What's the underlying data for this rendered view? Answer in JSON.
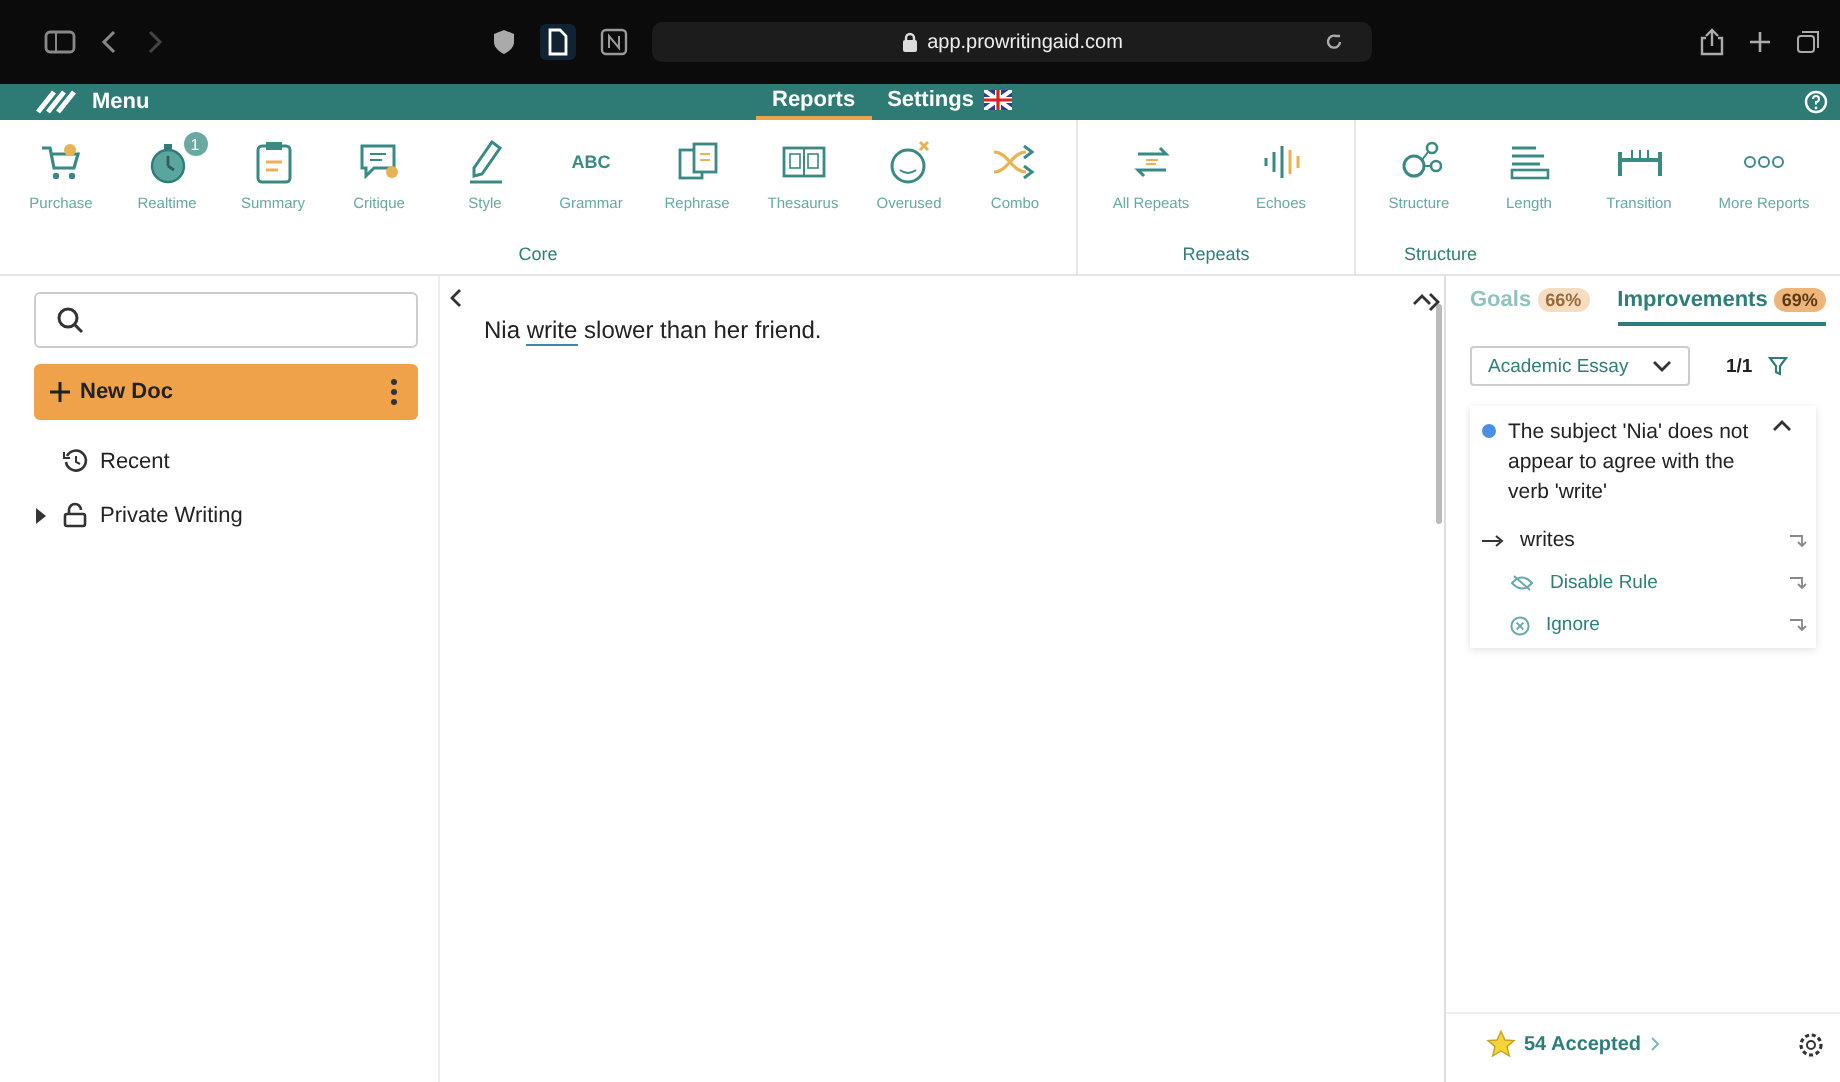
{
  "browser": {
    "url": "app.prowritingaid.com"
  },
  "menubar": {
    "title": "Menu",
    "tabs": [
      {
        "label": "Reports",
        "selected": true,
        "flag": false
      },
      {
        "label": "Settings",
        "selected": false,
        "flag": true
      }
    ]
  },
  "toolbar": {
    "groups": [
      {
        "label": "Core",
        "tools": [
          {
            "label": "Purchase",
            "kind": "cart"
          },
          {
            "label": "Realtime",
            "kind": "timer",
            "badge": "1"
          },
          {
            "label": "Summary",
            "kind": "clipboard"
          },
          {
            "label": "Critique",
            "kind": "chat"
          },
          {
            "label": "Style",
            "kind": "pen"
          },
          {
            "label": "Grammar",
            "kind": "text",
            "glyph": "ABC"
          },
          {
            "label": "Rephrase",
            "kind": "pages"
          },
          {
            "label": "Thesaurus",
            "kind": "book"
          },
          {
            "label": "Overused",
            "kind": "face"
          },
          {
            "label": "Combo",
            "kind": "shuffle"
          }
        ]
      },
      {
        "label": "Repeats",
        "tools": [
          {
            "label": "All Repeats",
            "kind": "repeat"
          },
          {
            "label": "Echoes",
            "kind": "wave"
          }
        ]
      },
      {
        "label": "Structure",
        "tools": [
          {
            "label": "Structure",
            "kind": "nodes"
          },
          {
            "label": "Length",
            "kind": "lines"
          },
          {
            "label": "Transition",
            "kind": "bridge"
          },
          {
            "label": "More Reports",
            "kind": "dots"
          }
        ]
      }
    ]
  },
  "sidebar": {
    "new_doc": "New Doc",
    "items": [
      {
        "label": "Recent",
        "kind": "recent"
      },
      {
        "label": "Private Writing",
        "kind": "folder",
        "expanded": false
      }
    ]
  },
  "editor": {
    "text_before": "Nia ",
    "flagged": "write",
    "text_after": " slower than her friend."
  },
  "panel": {
    "tabs": [
      {
        "label": "Goals",
        "score": "66%",
        "selected": false
      },
      {
        "label": "Improvements",
        "score": "69%",
        "selected": true
      }
    ],
    "filter": "Academic Essay",
    "count": "1/1",
    "suggestion": {
      "color": "#4a90e2",
      "message": "The subject 'Nia' does not appear to agree with the verb 'write'",
      "expanded": true,
      "actions": [
        {
          "label": "writes",
          "kind": "replace"
        },
        {
          "label": "Disable Rule",
          "kind": "disable"
        },
        {
          "label": "Ignore",
          "kind": "ignore"
        }
      ]
    },
    "accepted": "54 Accepted"
  }
}
